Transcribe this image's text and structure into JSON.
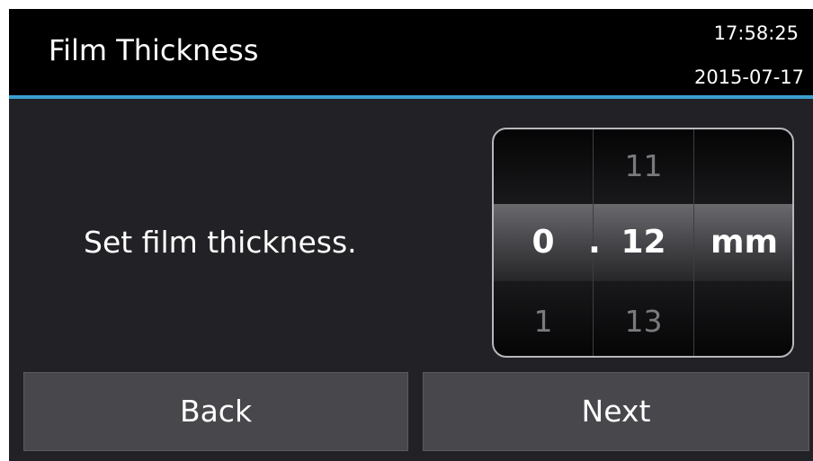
{
  "header": {
    "title": "Film Thickness",
    "time": "17:58:25",
    "date": "2015-07-17"
  },
  "main": {
    "prompt": "Set film thickness."
  },
  "picker": {
    "integer_column": {
      "above": "",
      "selected": "0",
      "below": "1"
    },
    "separator": ".",
    "decimal_column": {
      "above": "11",
      "selected": "12",
      "below": "13"
    },
    "unit": "mm"
  },
  "buttons": {
    "back_label": "Back",
    "next_label": "Next"
  },
  "colors": {
    "background": "#222226",
    "header": "#000000",
    "accent_line": "#3a9fd0",
    "button": "#48484c"
  }
}
